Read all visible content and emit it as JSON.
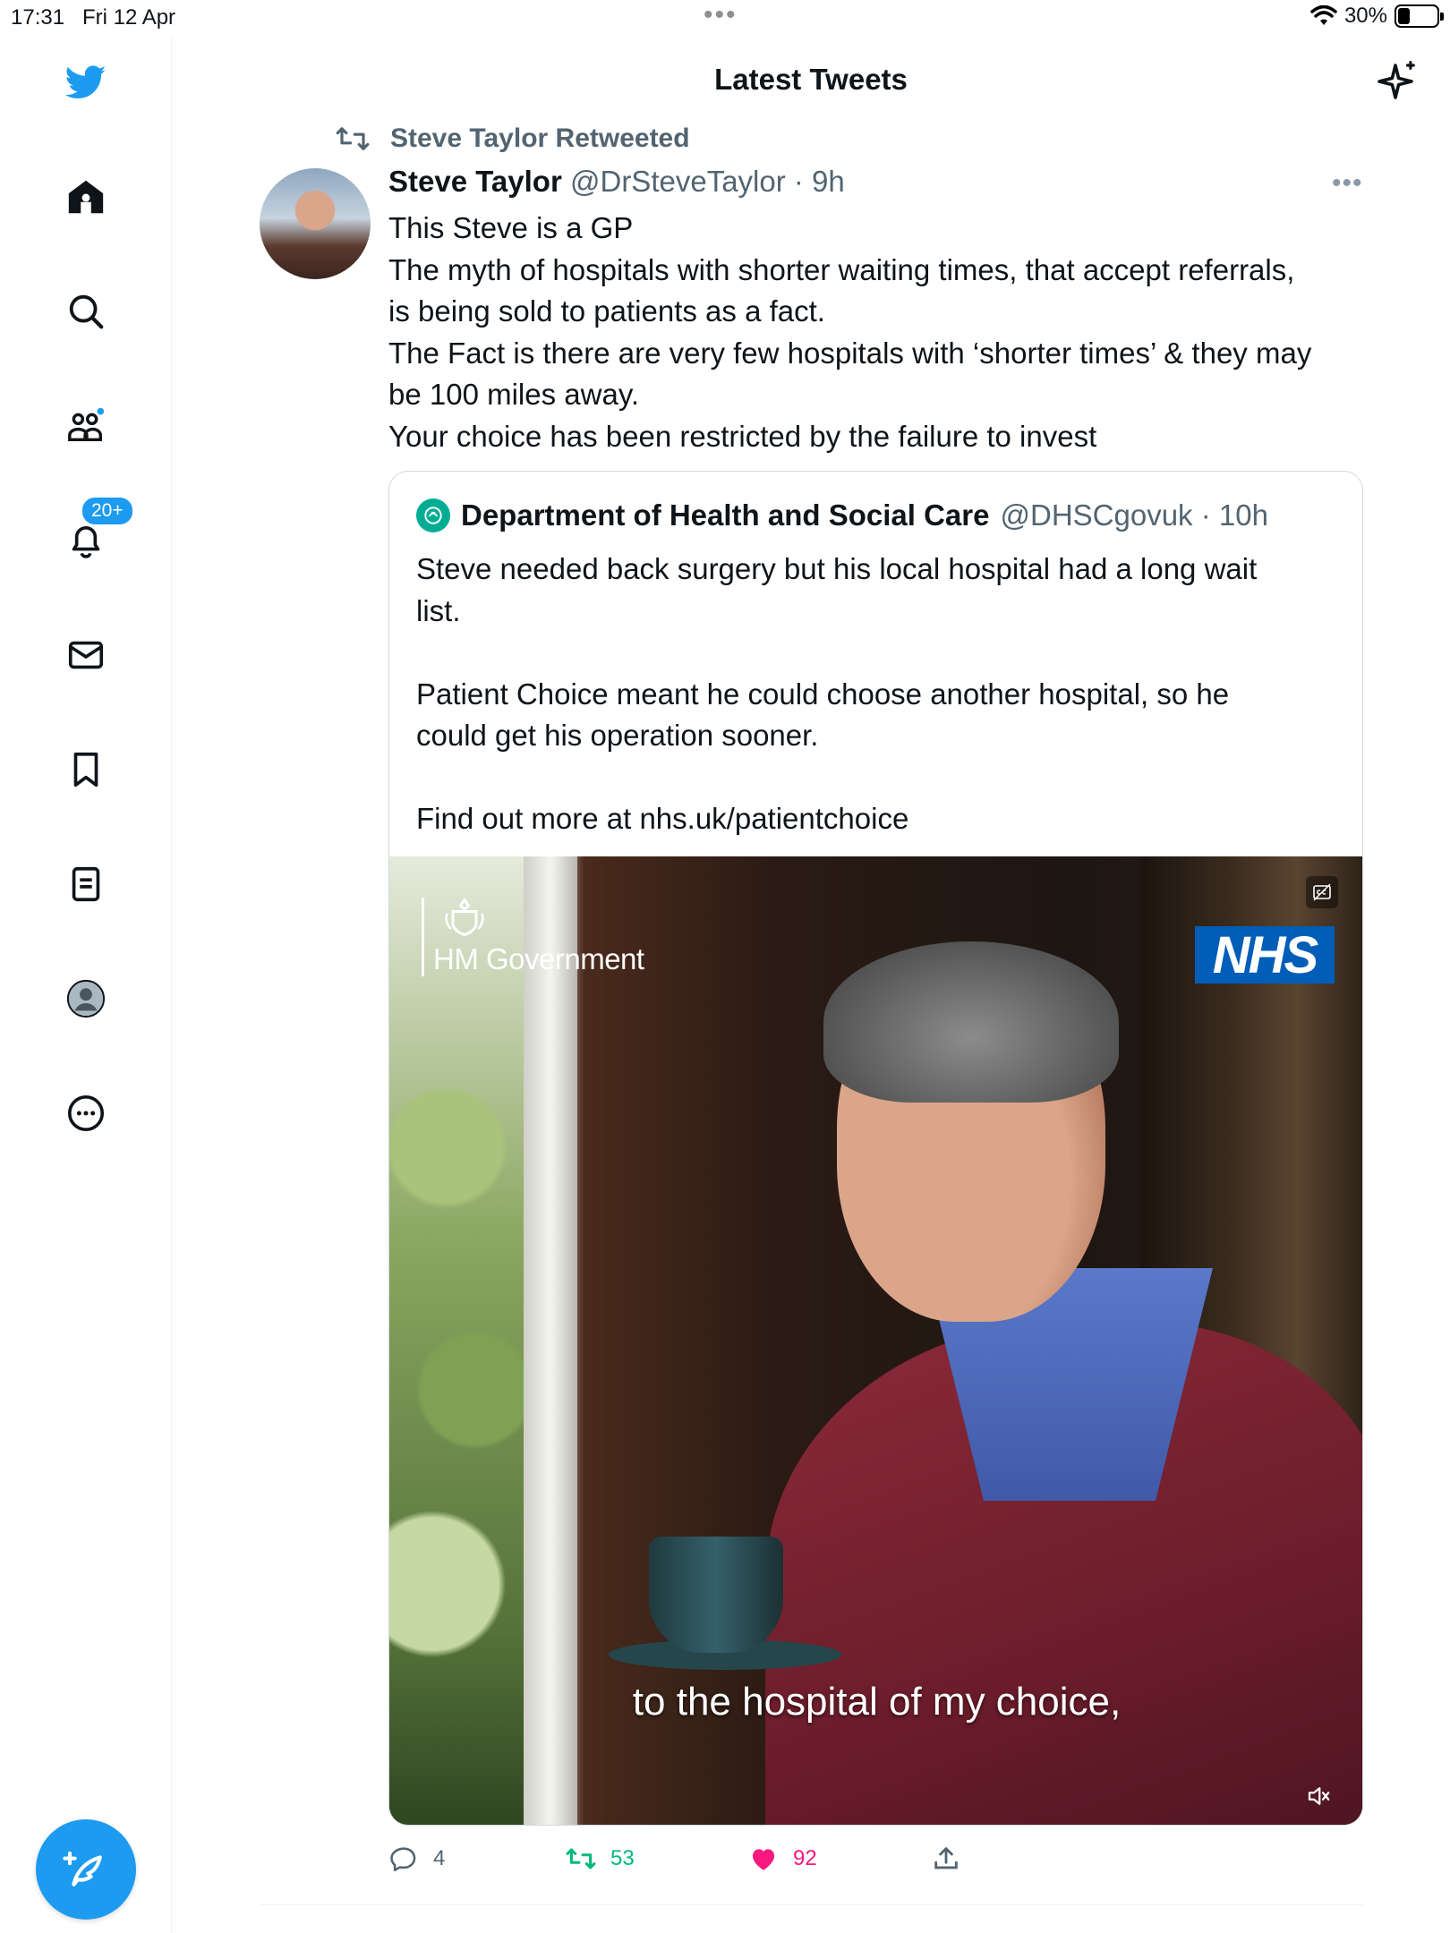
{
  "status_bar": {
    "time": "17:31",
    "date": "Fri 12 Apr",
    "battery": "30%",
    "battery_level": 0.3
  },
  "sidebar": {
    "items": [
      {
        "icon": "twitter-bird-icon"
      },
      {
        "icon": "home-icon"
      },
      {
        "icon": "search-icon"
      },
      {
        "icon": "communities-icon"
      },
      {
        "icon": "notifications-bell-icon"
      },
      {
        "icon": "messages-envelope-icon"
      },
      {
        "icon": "bookmark-icon"
      },
      {
        "icon": "lists-icon"
      },
      {
        "icon": "profile-avatar-icon"
      },
      {
        "icon": "more-circle-icon"
      }
    ],
    "notifications_badge": "20+",
    "compose_icon": "compose-feather-icon"
  },
  "header": {
    "title": "Latest Tweets",
    "sparkle_icon": "sparkle-icon"
  },
  "tweet": {
    "retweeted_by": "Steve Taylor Retweeted",
    "author_name": "Steve Taylor",
    "author_meta": "@DrSteveTaylor · 9h",
    "text_lines": [
      "This Steve is a GP",
      "The myth of hospitals with shorter waiting times, that accept referrals,",
      "is being sold to patients as a fact.",
      "The Fact is there are very few hospitals with ‘shorter times’ & they may",
      "be 100 miles away.",
      "Your choice has been restricted by the failure to invest"
    ],
    "quoted": {
      "author_name": "Department of Health and Social Care",
      "author_meta": "@DHSCgovuk · 10h",
      "text_lines": [
        "Steve needed back surgery but his local hospital had a long wait",
        "list.",
        "",
        "Patient Choice meant he could choose another hospital, so he",
        "could get his operation sooner.",
        "",
        "Find out more at nhs.uk/patientchoice"
      ],
      "media": {
        "hm_government": "HM Government",
        "nhs_logo": "NHS",
        "subtitle": "to the hospital of my choice,"
      }
    },
    "actions": {
      "replies": "4",
      "retweets": "53",
      "likes": "92"
    }
  },
  "colors": {
    "accent": "#1d9bf0",
    "retweet": "#00ba7c",
    "like": "#f91880",
    "muted": "#536471"
  }
}
